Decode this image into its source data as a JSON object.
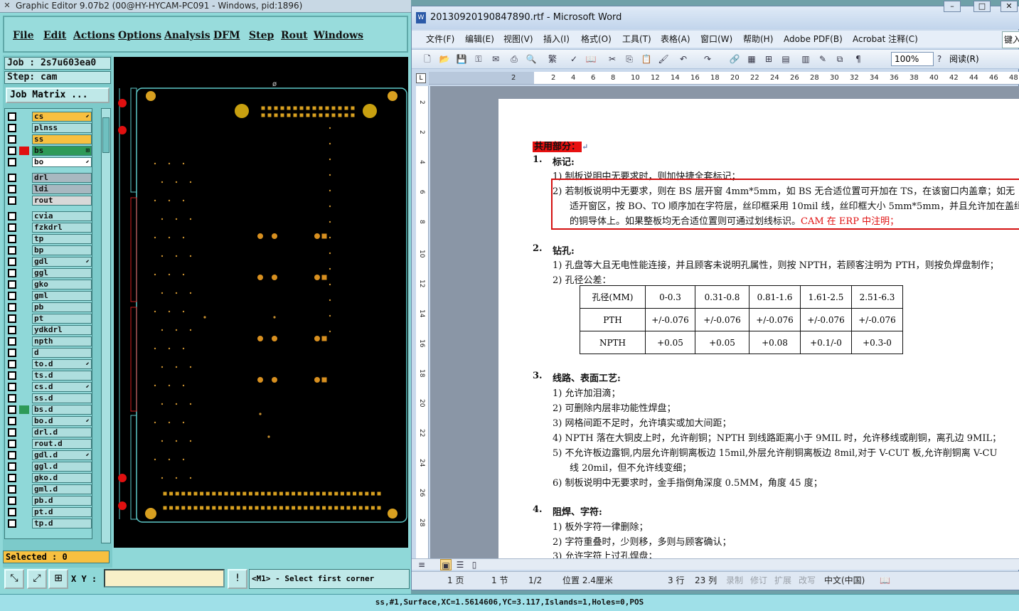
{
  "ge": {
    "title": "Graphic Editor 9.07b2 (00@HY-HYCAM-PC091 - Windows, pid:1896)",
    "menu": [
      "File",
      "Edit",
      "Actions",
      "Options",
      "Analysis",
      "DFM",
      "Step",
      "Rout",
      "Windows"
    ],
    "job": "Job : 2s7u603ea0",
    "step": "Step: cam",
    "job_matrix": "Job Matrix ...",
    "layers": [
      {
        "name": "cs",
        "color": "#f8c040",
        "mark": "",
        "icon": "⬋"
      },
      {
        "name": "plnss",
        "color": "#aedede",
        "mark": "",
        "icon": ""
      },
      {
        "name": "ss",
        "color": "#f8c040",
        "mark": "",
        "icon": ""
      },
      {
        "name": "bs",
        "color": "#2e9a58",
        "mark": "#e01010",
        "icon": "⊞"
      },
      {
        "name": "bo",
        "color": "#ffffff",
        "mark": "",
        "icon": "⬋"
      },
      {
        "name": "drl",
        "color": "#a8b8c0",
        "mark": "",
        "icon": ""
      },
      {
        "name": "ldi",
        "color": "#a8b8c0",
        "mark": "",
        "icon": ""
      },
      {
        "name": "rout",
        "color": "#d8d8d8",
        "mark": "",
        "icon": ""
      },
      {
        "name": "cvia",
        "color": "#aedede",
        "mark": "",
        "icon": ""
      },
      {
        "name": "fzkdrl",
        "color": "#aedede",
        "mark": "",
        "icon": ""
      },
      {
        "name": "tp",
        "color": "#aedede",
        "mark": "",
        "icon": ""
      },
      {
        "name": "bp",
        "color": "#aedede",
        "mark": "",
        "icon": ""
      },
      {
        "name": "gdl",
        "color": "#aedede",
        "mark": "",
        "icon": "⬋"
      },
      {
        "name": "ggl",
        "color": "#aedede",
        "mark": "",
        "icon": ""
      },
      {
        "name": "gko",
        "color": "#aedede",
        "mark": "",
        "icon": ""
      },
      {
        "name": "gml",
        "color": "#aedede",
        "mark": "",
        "icon": ""
      },
      {
        "name": "pb",
        "color": "#aedede",
        "mark": "",
        "icon": ""
      },
      {
        "name": "pt",
        "color": "#aedede",
        "mark": "",
        "icon": ""
      },
      {
        "name": "ydkdrl",
        "color": "#aedede",
        "mark": "",
        "icon": ""
      },
      {
        "name": "npth",
        "color": "#aedede",
        "mark": "",
        "icon": ""
      },
      {
        "name": "d",
        "color": "#aedede",
        "mark": "",
        "icon": ""
      },
      {
        "name": "to.d",
        "color": "#aedede",
        "mark": "",
        "icon": "⬋"
      },
      {
        "name": "ts.d",
        "color": "#aedede",
        "mark": "",
        "icon": ""
      },
      {
        "name": "cs.d",
        "color": "#aedede",
        "mark": "",
        "icon": "⬋"
      },
      {
        "name": "ss.d",
        "color": "#aedede",
        "mark": "",
        "icon": ""
      },
      {
        "name": "bs.d",
        "color": "#aedede",
        "mark": "#2e9a58",
        "icon": ""
      },
      {
        "name": "bo.d",
        "color": "#aedede",
        "mark": "",
        "icon": "⬋"
      },
      {
        "name": "drl.d",
        "color": "#aedede",
        "mark": "",
        "icon": ""
      },
      {
        "name": "rout.d",
        "color": "#aedede",
        "mark": "",
        "icon": ""
      },
      {
        "name": "gdl.d",
        "color": "#aedede",
        "mark": "",
        "icon": "⬋"
      },
      {
        "name": "ggl.d",
        "color": "#aedede",
        "mark": "",
        "icon": ""
      },
      {
        "name": "gko.d",
        "color": "#aedede",
        "mark": "",
        "icon": ""
      },
      {
        "name": "gml.d",
        "color": "#aedede",
        "mark": "",
        "icon": ""
      },
      {
        "name": "pb.d",
        "color": "#aedede",
        "mark": "",
        "icon": ""
      },
      {
        "name": "pt.d",
        "color": "#aedede",
        "mark": "",
        "icon": ""
      },
      {
        "name": "tp.d",
        "color": "#aedede",
        "mark": "",
        "icon": ""
      }
    ],
    "selected": "Selected : 0",
    "xy_label": "X Y :",
    "xy_value": "",
    "prompt": "<M1> - Select first corner",
    "status": "ss,#1,Surface,XC=1.5614606,YC=3.117,Islands=1,Holes=0,POS",
    "canvas_origin_label": "ø"
  },
  "word": {
    "title": "20130920190847890.rtf - Microsoft Word",
    "menu": [
      "文件(F)",
      "编辑(E)",
      "视图(V)",
      "插入(I)",
      "格式(O)",
      "工具(T)",
      "表格(A)",
      "窗口(W)",
      "帮助(H)",
      "Adobe PDF(B)",
      "Acrobat 注释(C)"
    ],
    "help_box": "键入",
    "zoom": "100%",
    "read_button": "阅读(R)",
    "ruler_numbers": [
      "2",
      "2",
      "4",
      "6",
      "8",
      "10",
      "12",
      "14",
      "16",
      "18",
      "20",
      "22",
      "24",
      "26",
      "28",
      "30",
      "32",
      "34",
      "36",
      "38",
      "40",
      "42",
      "44",
      "46",
      "48"
    ],
    "vruler_numbers": [
      "2",
      "2",
      "4",
      "6",
      "8",
      "10",
      "12",
      "14",
      "16",
      "18",
      "20",
      "22",
      "24",
      "26",
      "28"
    ],
    "status": {
      "page": "1 页",
      "section": "1 节",
      "pages": "1/2",
      "position": "位置 2.4厘米",
      "line": "3 行",
      "col": "23 列",
      "rec": "录制",
      "trk": "修订",
      "ext": "扩展",
      "ovr": "改写",
      "lang": "中文(中国)"
    },
    "doc": {
      "shared": "共用部分：",
      "s1_num": "1.",
      "s1": "标记:",
      "s1_1": "1) 制板说明中无要求时，则加快捷全套标记；",
      "s1_2a": "2) 若制板说明中无要求，则在 BS 层开窗 4mm*5mm，如 BS 无合适位置可开加在 TS，在该窗口内盖章；如无",
      "s1_2b": "适开窗区，按 BO、TO 顺序加在字符层，丝印框采用 10mil 线，丝印框大小 5mm*5mm，并且允许加在盖绿",
      "s1_2c": "的铜导体上。如果整板均无合适位置则可通过划线标识。",
      "s1_2red": "CAM 在 ERP 中注明；",
      "s2_num": "2.",
      "s2": "钻孔:",
      "s2_1": "1) 孔盘等大且无电性能连接，并且顾客未说明孔属性，则按 NPTH，若顾客注明为 PTH，则按负焊盘制作；",
      "s2_2": "2) 孔径公差：",
      "table": {
        "header": [
          "孔径(MM)",
          "0-0.3",
          "0.31-0.8",
          "0.81-1.6",
          "1.61-2.5",
          "2.51-6.3"
        ],
        "rows": [
          [
            "PTH",
            "+/-0.076",
            "+/-0.076",
            "+/-0.076",
            "+/-0.076",
            "+/-0.076"
          ],
          [
            "NPTH",
            "+0.05",
            "+0.05",
            "+0.08",
            "+0.1/-0",
            "+0.3-0"
          ]
        ]
      },
      "s3_num": "3.",
      "s3": "线路、表面工艺:",
      "s3_1": "1) 允许加泪滴；",
      "s3_2": "2) 可删除内层非功能性焊盘；",
      "s3_3": "3) 网格间距不足时，允许填实或加大间距；",
      "s3_4": "4) NPTH 落在大铜皮上时，允许削铜；NPTH 到线路距离小于 9MIL 时，允许移线或削铜，离孔边 9MIL；",
      "s3_5a": "5) 不允许板边露铜,内层允许削铜离板边 15mil,外层允许削铜离板边 8mil,对于 V-CUT 板,允许削铜离 V-CU",
      "s3_5b": "线 20mil，但不允许线变细；",
      "s3_6": "6) 制板说明中无要求时，金手指倒角深度 0.5MM，角度 45 度；",
      "s4_num": "4.",
      "s4": "阻焊、字符:",
      "s4_1": "1) 板外字符一律删除；",
      "s4_2": "2) 字符重叠时，少则移，多则与顾客确认；",
      "s4_3": "3) 允许字符上过孔焊盘；"
    }
  }
}
